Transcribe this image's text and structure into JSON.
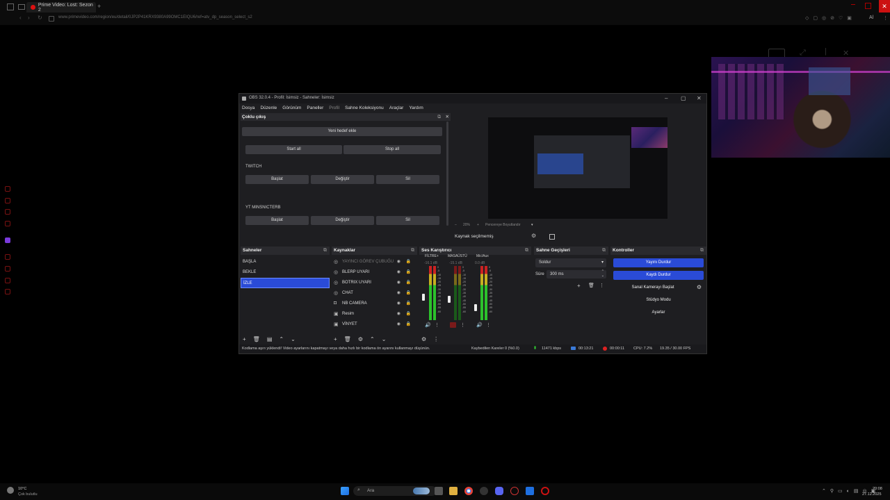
{
  "browser": {
    "tab_title": "Prime Video: Lost: Sezon 2",
    "new_tab": "+",
    "url": "www.primevideo.com/region/eu/detail/0JP2P41KRX9380A99OMC1EIQU6/ref=atv_dp_season_select_s2",
    "profile": "Al"
  },
  "obs": {
    "window_title": "OBS 32.0.4 - Profil: İsimsiz - Sahneler: İsimsiz",
    "menu": [
      "Dosya",
      "Düzenle",
      "Görünüm",
      "Paneller",
      "Profil",
      "Sahne Koleksiyonu",
      "Araçlar",
      "Yardım"
    ],
    "multi_output": {
      "title": "Çoklu çıkış",
      "add_target": "Yeni hedef ekle",
      "start_all": "Start all",
      "stop_all": "Stop all",
      "targets": [
        {
          "name": "TWITCH",
          "start": "Başlat",
          "edit": "Değiştir",
          "delete": "Sil"
        },
        {
          "name": "YT MINSNICTERB",
          "start": "Başlat",
          "edit": "Değiştir",
          "delete": "Sil"
        }
      ]
    },
    "preview": {
      "zoom": "20%",
      "fit": "Pencereye Boyutlandır",
      "no_source": "Kaynak seçilmemiş"
    },
    "scenes": {
      "title": "Sahneler",
      "items": [
        "BAŞLA",
        "BEKLE",
        "İZLE"
      ],
      "selected_index": 2
    },
    "sources": {
      "title": "Kaynaklar",
      "items": [
        "YAYINCI GÖREV ÇUBUĞU",
        "BLERP UYARI",
        "BOTRIX UYARI",
        "CHAT",
        "NB CAMERA",
        "Resim",
        "VİNYET"
      ]
    },
    "mixer": {
      "title": "Ses Karıştırıcı",
      "channels": [
        {
          "name": "FİLTRE+",
          "db": "-16.1 dB",
          "level": 0.75
        },
        {
          "name": "MASAÜSTÜ",
          "db": "-15.1 dB",
          "level": 0.7
        },
        {
          "name": "Mic/Aux",
          "db": "0.0 dB",
          "level": 0.55
        }
      ],
      "scale": [
        "0",
        "-5",
        "-10",
        "-15",
        "-20",
        "-25",
        "-30",
        "-35",
        "-40",
        "-45",
        "-50",
        "-55",
        "-60"
      ]
    },
    "transitions": {
      "title": "Sahne Geçişleri",
      "selected": "Soldur",
      "duration_label": "Süre",
      "duration_value": "300 ms"
    },
    "controls": {
      "title": "Kontroller",
      "stop_stream": "Yayını Durdur",
      "stop_record": "Kaydı Durdur",
      "virtual_cam": "Sanal Kamerayı Başlat",
      "studio_mode": "Stüdyo Modu",
      "settings": "Ayarlar"
    },
    "status": {
      "warning": "Kodlama aşırı yüklendi! Video ayarlarını kapatmayı veya daha hızlı bir kodlama ön ayarını kullanmayı düşünün.",
      "dropped": "Kaybedilen Kareler 0 (%0.0)",
      "bitrate": "11471 kbps",
      "stream_time": "00:13:21",
      "rec_time": "00:00:11",
      "cpu": "CPU: 7.2%",
      "fps": "19.35 / 30.00 FPS"
    }
  },
  "taskbar": {
    "weather_temp": "10°C",
    "weather_desc": "Çok bulutlu",
    "search": "Ara",
    "time": "20:08",
    "date": "27.12.2025"
  },
  "colors": {
    "accent_blue": "#2a4bd7",
    "browser_red": "#d11111"
  }
}
